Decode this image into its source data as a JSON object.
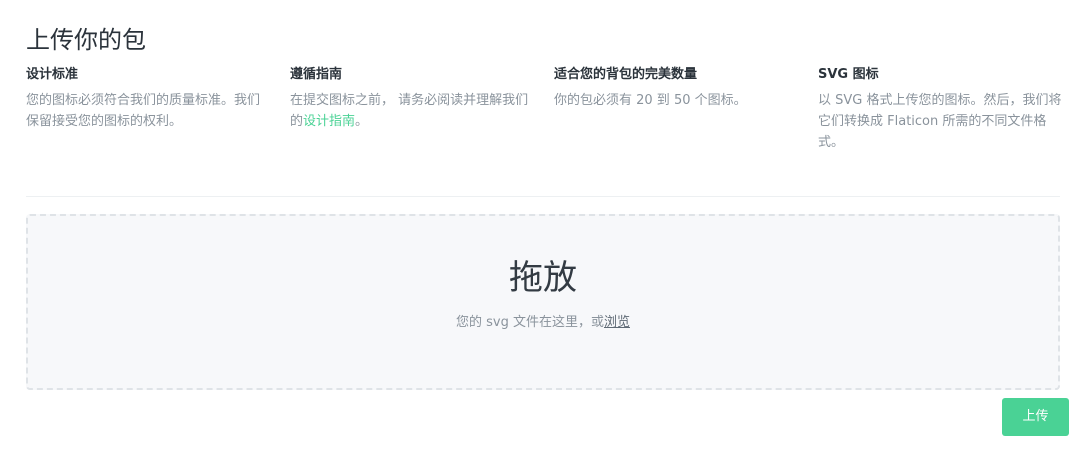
{
  "page": {
    "title": "上传你的包"
  },
  "info": [
    {
      "title": "设计标准",
      "text": "您的图标必须符合我们的质量标准。我们保留接受您的图标的权利。"
    },
    {
      "title": "遵循指南",
      "text_before": "在提交图标之前， 请务必阅读并理解我们的",
      "link": "设计指南",
      "text_after": "。"
    },
    {
      "title": "适合您的背包的完美数量",
      "text": "你的包必须有 20 到 50 个图标。"
    },
    {
      "title": "SVG 图标",
      "text": "以 SVG 格式上传您的图标。然后，我们将它们转换成 Flaticon 所需的不同文件格式。"
    }
  ],
  "dropzone": {
    "title": "拖放",
    "hint_prefix": "您的 svg 文件在这里，或",
    "browse": "浏览"
  },
  "actions": {
    "upload_label": "上传"
  },
  "colors": {
    "accent": "#4ad295",
    "dropzone_bg": "#f7f8fa",
    "dropzone_border": "#dfe3e7"
  }
}
